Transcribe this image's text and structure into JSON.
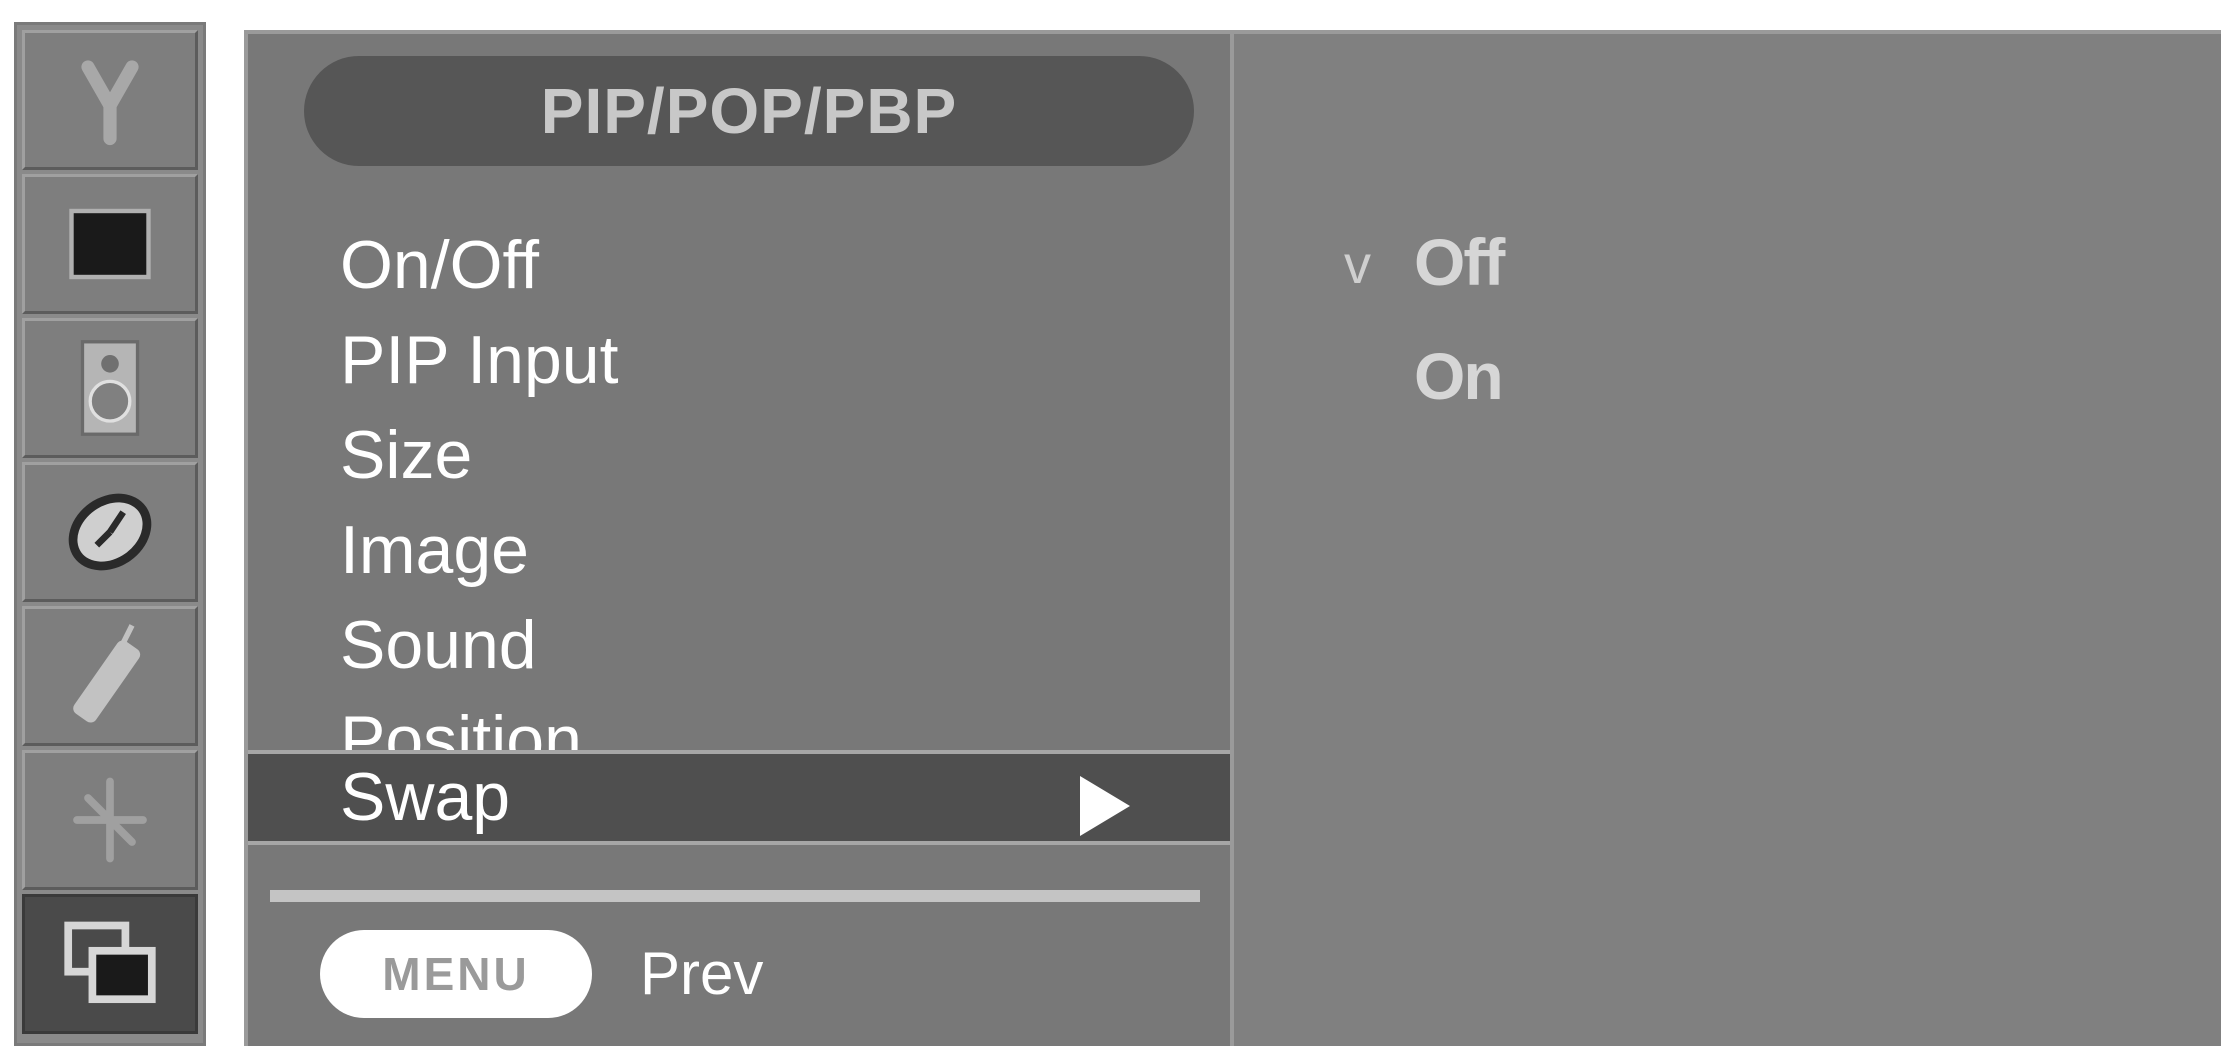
{
  "icons": [
    {
      "name": "setup-icon"
    },
    {
      "name": "picture-icon"
    },
    {
      "name": "speaker-icon"
    },
    {
      "name": "time-icon"
    },
    {
      "name": "remote-icon"
    },
    {
      "name": "special-icon"
    },
    {
      "name": "pip-icon",
      "active": true
    }
  ],
  "menu": {
    "title": "PIP/POP/PBP",
    "items": [
      {
        "label": "On/Off"
      },
      {
        "label": "PIP Input"
      },
      {
        "label": "Size"
      },
      {
        "label": "Image"
      },
      {
        "label": "Sound"
      },
      {
        "label": "Position"
      },
      {
        "label": "Swap",
        "selected": true
      }
    ],
    "menu_button_label": "MENU",
    "prev_label": "Prev"
  },
  "submenu": {
    "check_symbol": "v",
    "options": [
      {
        "label": "Off",
        "checked": true
      },
      {
        "label": "On",
        "checked": false
      }
    ]
  },
  "colors": {
    "panel": "#787878",
    "selected_row": "#4f4f4f",
    "title_pill": "#565656",
    "right_panel": "#808080"
  }
}
